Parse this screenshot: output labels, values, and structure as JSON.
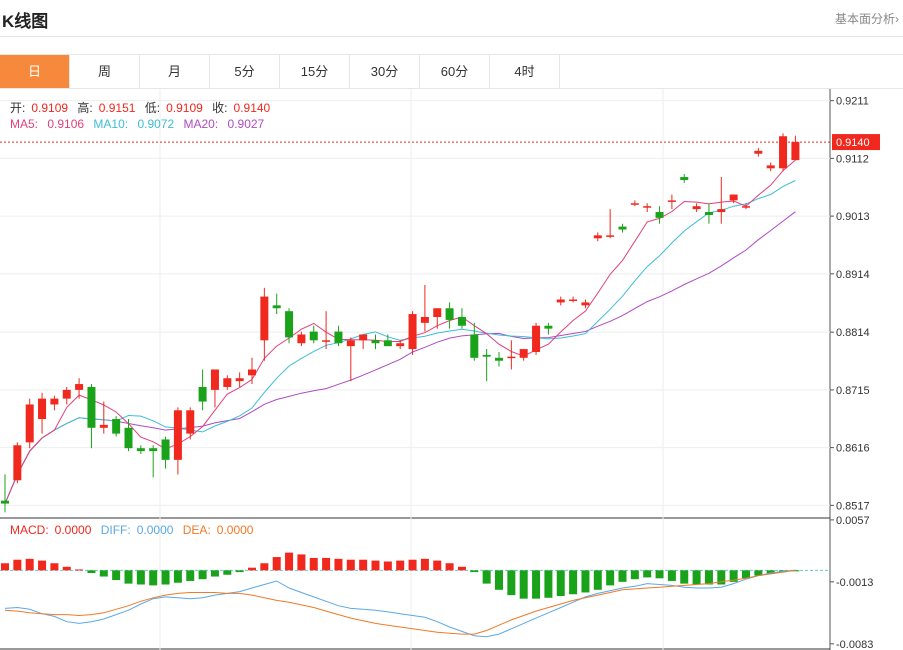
{
  "header": {
    "title": "K线图",
    "link": "基本面分析›"
  },
  "tabs": [
    {
      "label": "日",
      "active": true
    },
    {
      "label": "周"
    },
    {
      "label": "月"
    },
    {
      "label": "5分"
    },
    {
      "label": "15分"
    },
    {
      "label": "30分"
    },
    {
      "label": "60分"
    },
    {
      "label": "4时"
    }
  ],
  "info": {
    "open_label": "开:",
    "open": "0.9109",
    "high_label": "高:",
    "high": "0.9151",
    "low_label": "低:",
    "low": "0.9109",
    "close_label": "收:",
    "close": "0.9140",
    "ma5_label": "MA5:",
    "ma5": "0.9106",
    "ma10_label": "MA10:",
    "ma10": "0.9072",
    "ma20_label": "MA20:",
    "ma20": "0.9027",
    "macd_label": "MACD:",
    "macd": "0.0000",
    "diff_label": "DIFF:",
    "diff": "0.0000",
    "dea_label": "DEA:",
    "dea": "0.0000"
  },
  "colors": {
    "up": "#f0281e",
    "down": "#1aa31a",
    "ma5": "#e0407a",
    "ma10": "#3cbdd9",
    "ma20": "#b04bc4",
    "diff": "#5aa9e6",
    "dea": "#f07a28",
    "accent": "#f6893b"
  },
  "chart_data": [
    {
      "type": "candlestick",
      "title": "",
      "ylim": [
        0.8497,
        0.9231
      ],
      "yticks": [
        "0.9211",
        "0.9112",
        "0.9013",
        "0.8914",
        "0.8814",
        "0.8715",
        "0.8616",
        "0.8517"
      ],
      "current_price_label": "0.9140",
      "candles": [
        [
          0.8525,
          0.857,
          0.8505,
          0.852
        ],
        [
          0.856,
          0.8625,
          0.8555,
          0.862
        ],
        [
          0.8625,
          0.87,
          0.8615,
          0.869
        ],
        [
          0.8665,
          0.871,
          0.864,
          0.87
        ],
        [
          0.869,
          0.8705,
          0.868,
          0.87
        ],
        [
          0.87,
          0.872,
          0.869,
          0.8715
        ],
        [
          0.8715,
          0.8735,
          0.87,
          0.8725
        ],
        [
          0.872,
          0.8725,
          0.8615,
          0.865
        ],
        [
          0.865,
          0.8695,
          0.864,
          0.8655
        ],
        [
          0.8665,
          0.867,
          0.8635,
          0.864
        ],
        [
          0.865,
          0.8665,
          0.861,
          0.8615
        ],
        [
          0.8615,
          0.862,
          0.8605,
          0.861
        ],
        [
          0.8615,
          0.862,
          0.8565,
          0.861
        ],
        [
          0.863,
          0.8635,
          0.858,
          0.8595
        ],
        [
          0.8595,
          0.8685,
          0.857,
          0.868
        ],
        [
          0.864,
          0.8685,
          0.863,
          0.868
        ],
        [
          0.872,
          0.875,
          0.868,
          0.8695
        ],
        [
          0.8715,
          0.8745,
          0.8685,
          0.875
        ],
        [
          0.872,
          0.874,
          0.8715,
          0.8735
        ],
        [
          0.873,
          0.8745,
          0.872,
          0.8735
        ],
        [
          0.874,
          0.877,
          0.8725,
          0.875
        ],
        [
          0.88,
          0.889,
          0.8765,
          0.8875
        ],
        [
          0.886,
          0.888,
          0.8845,
          0.8855
        ],
        [
          0.885,
          0.8855,
          0.8795,
          0.8805
        ],
        [
          0.8795,
          0.8815,
          0.879,
          0.881
        ],
        [
          0.8815,
          0.8825,
          0.8795,
          0.88
        ],
        [
          0.88,
          0.885,
          0.8785,
          0.88
        ],
        [
          0.8815,
          0.8825,
          0.879,
          0.8795
        ],
        [
          0.879,
          0.8805,
          0.873,
          0.88
        ],
        [
          0.88,
          0.881,
          0.8785,
          0.881
        ],
        [
          0.88,
          0.881,
          0.8785,
          0.8795
        ],
        [
          0.88,
          0.881,
          0.879,
          0.879
        ],
        [
          0.879,
          0.88,
          0.8785,
          0.8795
        ],
        [
          0.8785,
          0.885,
          0.8775,
          0.8845
        ],
        [
          0.883,
          0.8895,
          0.8815,
          0.884
        ],
        [
          0.884,
          0.8855,
          0.882,
          0.8855
        ],
        [
          0.8855,
          0.8865,
          0.882,
          0.8835
        ],
        [
          0.884,
          0.8855,
          0.882,
          0.8825
        ],
        [
          0.881,
          0.883,
          0.8765,
          0.877
        ],
        [
          0.8775,
          0.8785,
          0.873,
          0.8772
        ],
        [
          0.877,
          0.878,
          0.8755,
          0.8765
        ],
        [
          0.877,
          0.88,
          0.875,
          0.8772
        ],
        [
          0.877,
          0.878,
          0.8765,
          0.8785
        ],
        [
          0.878,
          0.883,
          0.8775,
          0.8825
        ],
        [
          0.8825,
          0.883,
          0.881,
          0.882
        ],
        [
          0.8865,
          0.8875,
          0.886,
          0.887
        ],
        [
          0.887,
          0.8875,
          0.8865,
          0.887
        ],
        [
          0.886,
          0.887,
          0.8855,
          0.8865
        ],
        [
          0.8975,
          0.8985,
          0.897,
          0.898
        ],
        [
          0.898,
          0.9025,
          0.8975,
          0.898
        ],
        [
          0.8995,
          0.9,
          0.8985,
          0.899
        ],
        [
          0.9035,
          0.904,
          0.903,
          0.9035
        ],
        [
          0.903,
          0.9035,
          0.902,
          0.903
        ],
        [
          0.902,
          0.903,
          0.9,
          0.901
        ],
        [
          0.904,
          0.905,
          0.9025,
          0.904
        ],
        [
          0.908,
          0.9085,
          0.907,
          0.9075
        ],
        [
          0.9025,
          0.9035,
          0.902,
          0.903
        ],
        [
          0.902,
          0.9035,
          0.9,
          0.9015
        ],
        [
          0.902,
          0.908,
          0.9,
          0.9025
        ],
        [
          0.904,
          0.905,
          0.9035,
          0.905
        ],
        [
          0.903,
          0.9035,
          0.9025,
          0.903
        ],
        [
          0.912,
          0.913,
          0.9115,
          0.9125
        ],
        [
          0.9095,
          0.9105,
          0.909,
          0.91
        ],
        [
          0.9095,
          0.9155,
          0.909,
          0.915
        ],
        [
          0.9109,
          0.9151,
          0.9109,
          0.914
        ]
      ]
    },
    {
      "type": "bar",
      "title": "",
      "ylim": [
        -0.009,
        0.0058
      ],
      "yticks": [
        "0.0057",
        "-0.0013",
        "-0.0083"
      ],
      "macd": [
        0.0008,
        0.0012,
        0.0013,
        0.0011,
        0.0008,
        0.0004,
        0.0001,
        -0.0003,
        -0.0007,
        -0.0011,
        -0.0015,
        -0.0016,
        -0.0017,
        -0.0016,
        -0.0014,
        -0.0012,
        -0.001,
        -0.0007,
        -0.0005,
        -0.0002,
        0.0003,
        0.0008,
        0.0015,
        0.002,
        0.0018,
        0.0014,
        0.0014,
        0.0013,
        0.0012,
        0.0012,
        0.0011,
        0.001,
        0.0011,
        0.0012,
        0.0013,
        0.0011,
        0.0008,
        0.0004,
        -0.0002,
        -0.0015,
        -0.0022,
        -0.0028,
        -0.0032,
        -0.0032,
        -0.0031,
        -0.0029,
        -0.0027,
        -0.0025,
        -0.0022,
        -0.0017,
        -0.0013,
        -0.001,
        -0.0008,
        -0.0009,
        -0.0012,
        -0.0015,
        -0.0016,
        -0.0016,
        -0.0016,
        -0.0013,
        -0.0009,
        -0.0006,
        -0.0004,
        -0.0002,
        -0.0001
      ],
      "diff": [
        -0.0043,
        -0.0042,
        -0.0044,
        -0.0049,
        -0.0052,
        -0.0058,
        -0.006,
        -0.0058,
        -0.0055,
        -0.005,
        -0.0045,
        -0.0038,
        -0.0032,
        -0.003,
        -0.0031,
        -0.0032,
        -0.0031,
        -0.0028,
        -0.0026,
        -0.0024,
        -0.002,
        -0.0016,
        -0.0012,
        -0.002,
        -0.0025,
        -0.003,
        -0.0035,
        -0.004,
        -0.0043,
        -0.0044,
        -0.0045,
        -0.0047,
        -0.0049,
        -0.0051,
        -0.0053,
        -0.0058,
        -0.0064,
        -0.0069,
        -0.0074,
        -0.0075,
        -0.0072,
        -0.0066,
        -0.006,
        -0.0054,
        -0.0048,
        -0.0042,
        -0.0036,
        -0.003,
        -0.0026,
        -0.0023,
        -0.002,
        -0.0018,
        -0.0015,
        -0.0016,
        -0.0017,
        -0.0019,
        -0.002,
        -0.002,
        -0.0019,
        -0.0015,
        -0.001,
        -0.0006,
        -0.0003,
        -0.0001,
        0.0
      ],
      "dea": [
        -0.0045,
        -0.0046,
        -0.0048,
        -0.0049,
        -0.005,
        -0.005,
        -0.0051,
        -0.005,
        -0.0048,
        -0.0044,
        -0.004,
        -0.0035,
        -0.0031,
        -0.0028,
        -0.0026,
        -0.0025,
        -0.0025,
        -0.0025,
        -0.0026,
        -0.0026,
        -0.0028,
        -0.0031,
        -0.0034,
        -0.0036,
        -0.0039,
        -0.0042,
        -0.0046,
        -0.005,
        -0.0054,
        -0.0057,
        -0.006,
        -0.0062,
        -0.0064,
        -0.0066,
        -0.0068,
        -0.007,
        -0.0071,
        -0.0072,
        -0.0072,
        -0.0068,
        -0.0062,
        -0.0056,
        -0.0051,
        -0.0046,
        -0.0042,
        -0.0038,
        -0.0034,
        -0.0031,
        -0.0028,
        -0.0025,
        -0.0022,
        -0.0021,
        -0.002,
        -0.0019,
        -0.0018,
        -0.0017,
        -0.0016,
        -0.0015,
        -0.0013,
        -0.0011,
        -0.0009,
        -0.0006,
        -0.0004,
        -0.0002,
        0.0
      ]
    }
  ]
}
